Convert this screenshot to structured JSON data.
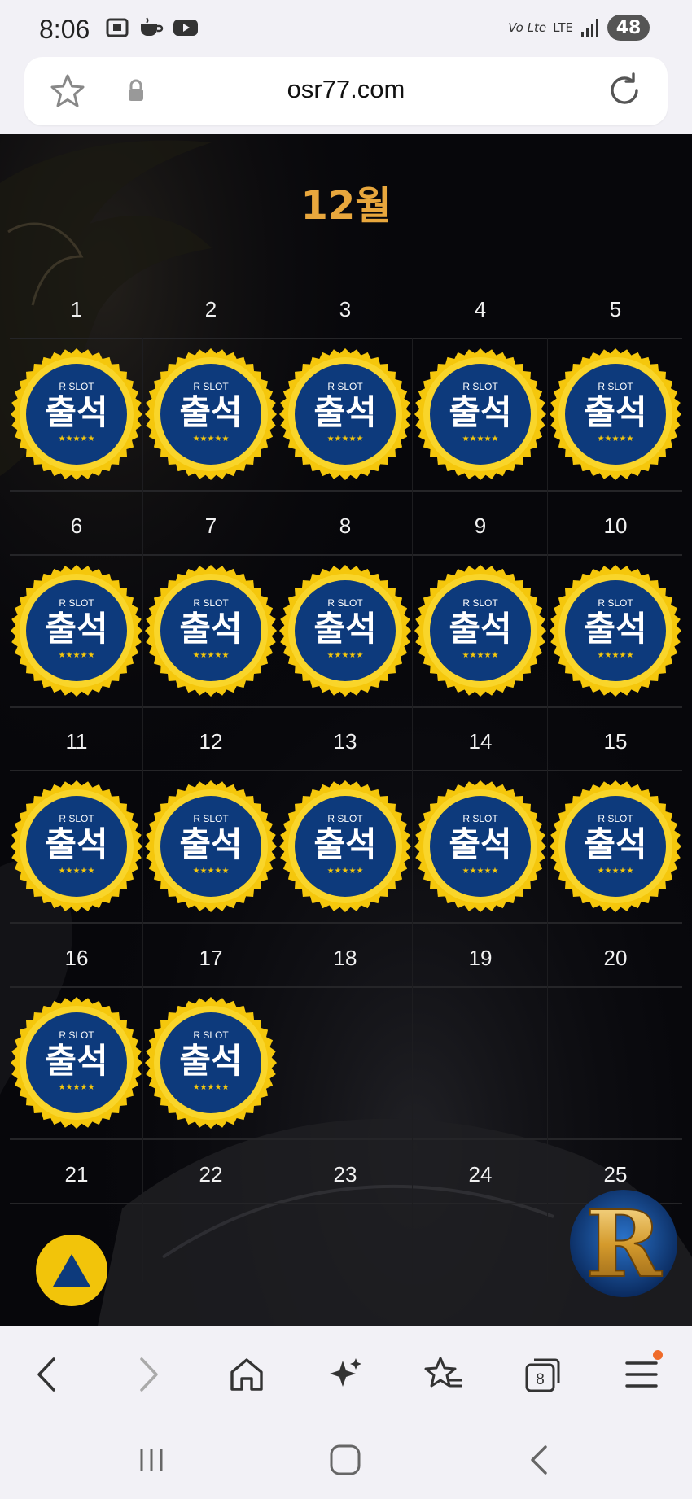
{
  "status_bar": {
    "time": "8:06",
    "volte": "Vo Lte",
    "network": "LTE",
    "battery": "48",
    "left_icons": [
      "screenshot-icon",
      "coffee-icon",
      "youtube-icon"
    ]
  },
  "url_bar": {
    "domain": "osr77.com"
  },
  "calendar": {
    "month_label": "12월",
    "badge": {
      "brand": "R SLOT",
      "text": "출석",
      "stars": "★★★★★"
    },
    "days": [
      "1",
      "2",
      "3",
      "4",
      "5",
      "6",
      "7",
      "8",
      "9",
      "10",
      "11",
      "12",
      "13",
      "14",
      "15",
      "16",
      "17",
      "18",
      "19",
      "20",
      "21",
      "22",
      "23",
      "24",
      "25"
    ],
    "attended_count": 17
  },
  "floating": {
    "logo_letter": "R"
  },
  "browser_nav": {
    "tab_count": "8",
    "items": [
      "back-button",
      "forward-button",
      "home-button",
      "ai-sparkle-button",
      "bookmarks-button",
      "tabs-button",
      "menu-button"
    ]
  },
  "colors": {
    "page_bg": "#07070b",
    "month": "#e8a73d",
    "badge_ring": "#f5c70c",
    "badge_center": "#0d3a7c",
    "scroll_top": "#f2c40a",
    "notification": "#ef6b2a"
  }
}
